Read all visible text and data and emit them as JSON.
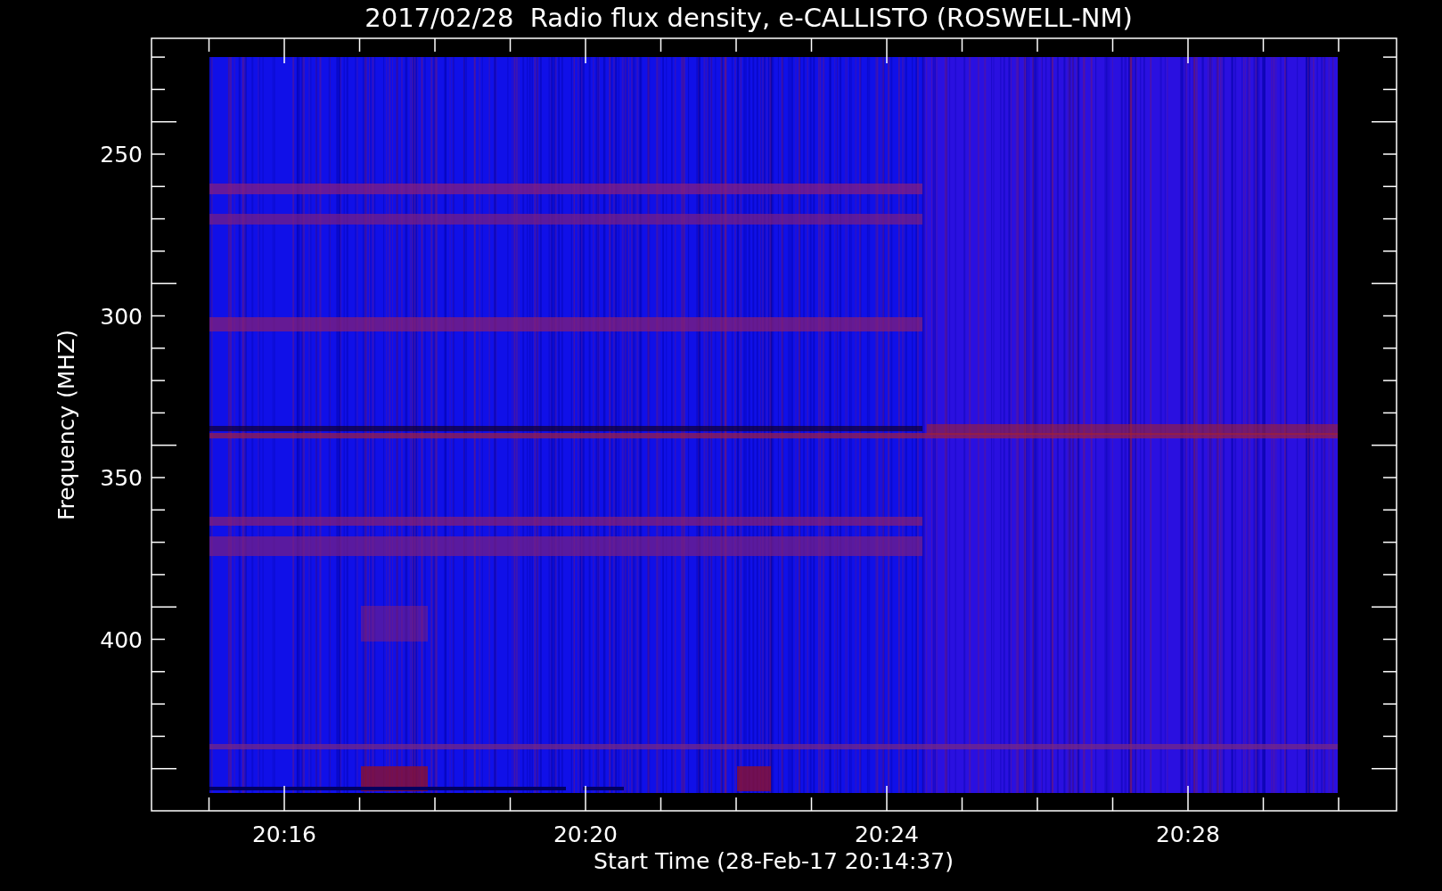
{
  "plot": {
    "title": "2017/02/28  Radio flux density, e-CALLISTO (ROSWELL-NM)",
    "y_axis": {
      "label": "Frequency (MHZ)",
      "tick_labels": [
        "250",
        "300",
        "350",
        "400"
      ]
    },
    "x_axis": {
      "label": "Start Time (28-Feb-17 20:14:37)",
      "tick_labels": [
        "20:16",
        "20:20",
        "20:24",
        "20:28"
      ]
    }
  }
}
